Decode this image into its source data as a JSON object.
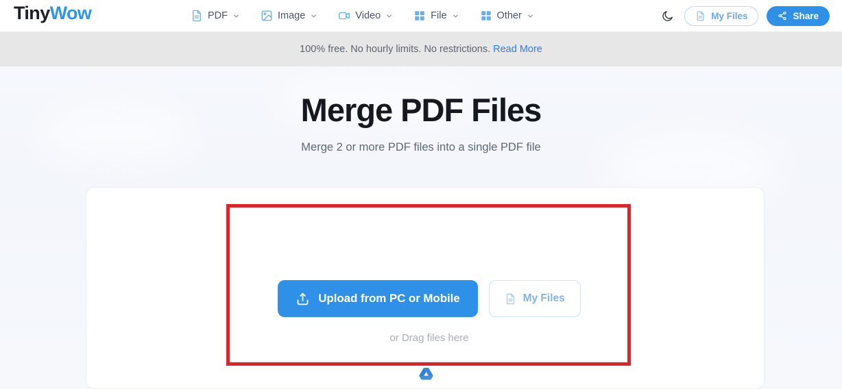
{
  "brand": {
    "name_part1": "Tiny",
    "name_part2": "Wow",
    "accent_color": "#2f90e8",
    "dark_color": "#15181f"
  },
  "header": {
    "nav_items": [
      {
        "label": "PDF",
        "icon": "document-icon"
      },
      {
        "label": "Image",
        "icon": "image-icon"
      },
      {
        "label": "Video",
        "icon": "video-camera-icon"
      },
      {
        "label": "File",
        "icon": "grid-icon"
      },
      {
        "label": "Other",
        "icon": "grid-icon"
      }
    ],
    "theme_toggle": {
      "icon": "moon-icon",
      "label": "Dark mode"
    },
    "my_files_button": {
      "label": "My Files",
      "icon": "document-icon"
    },
    "share_button": {
      "label": "Share",
      "icon": "share-nodes-icon"
    }
  },
  "notice": {
    "text": "100% free. No hourly limits. No restrictions.",
    "link_label": "Read More"
  },
  "hero": {
    "title": "Merge PDF Files",
    "subtitle": "Merge 2 or more PDF files into a single PDF file"
  },
  "upload": {
    "primary_button": {
      "label": "Upload from PC or Mobile",
      "icon": "upload-icon"
    },
    "secondary_button": {
      "label": "My Files",
      "icon": "document-icon"
    },
    "drag_hint": "or Drag files here",
    "google_drive": {
      "icon": "google-drive-icon",
      "label": "Google Drive"
    }
  },
  "annotation": {
    "shape": "rectangle",
    "color": "#e02329",
    "target": "upload-dropzone"
  }
}
